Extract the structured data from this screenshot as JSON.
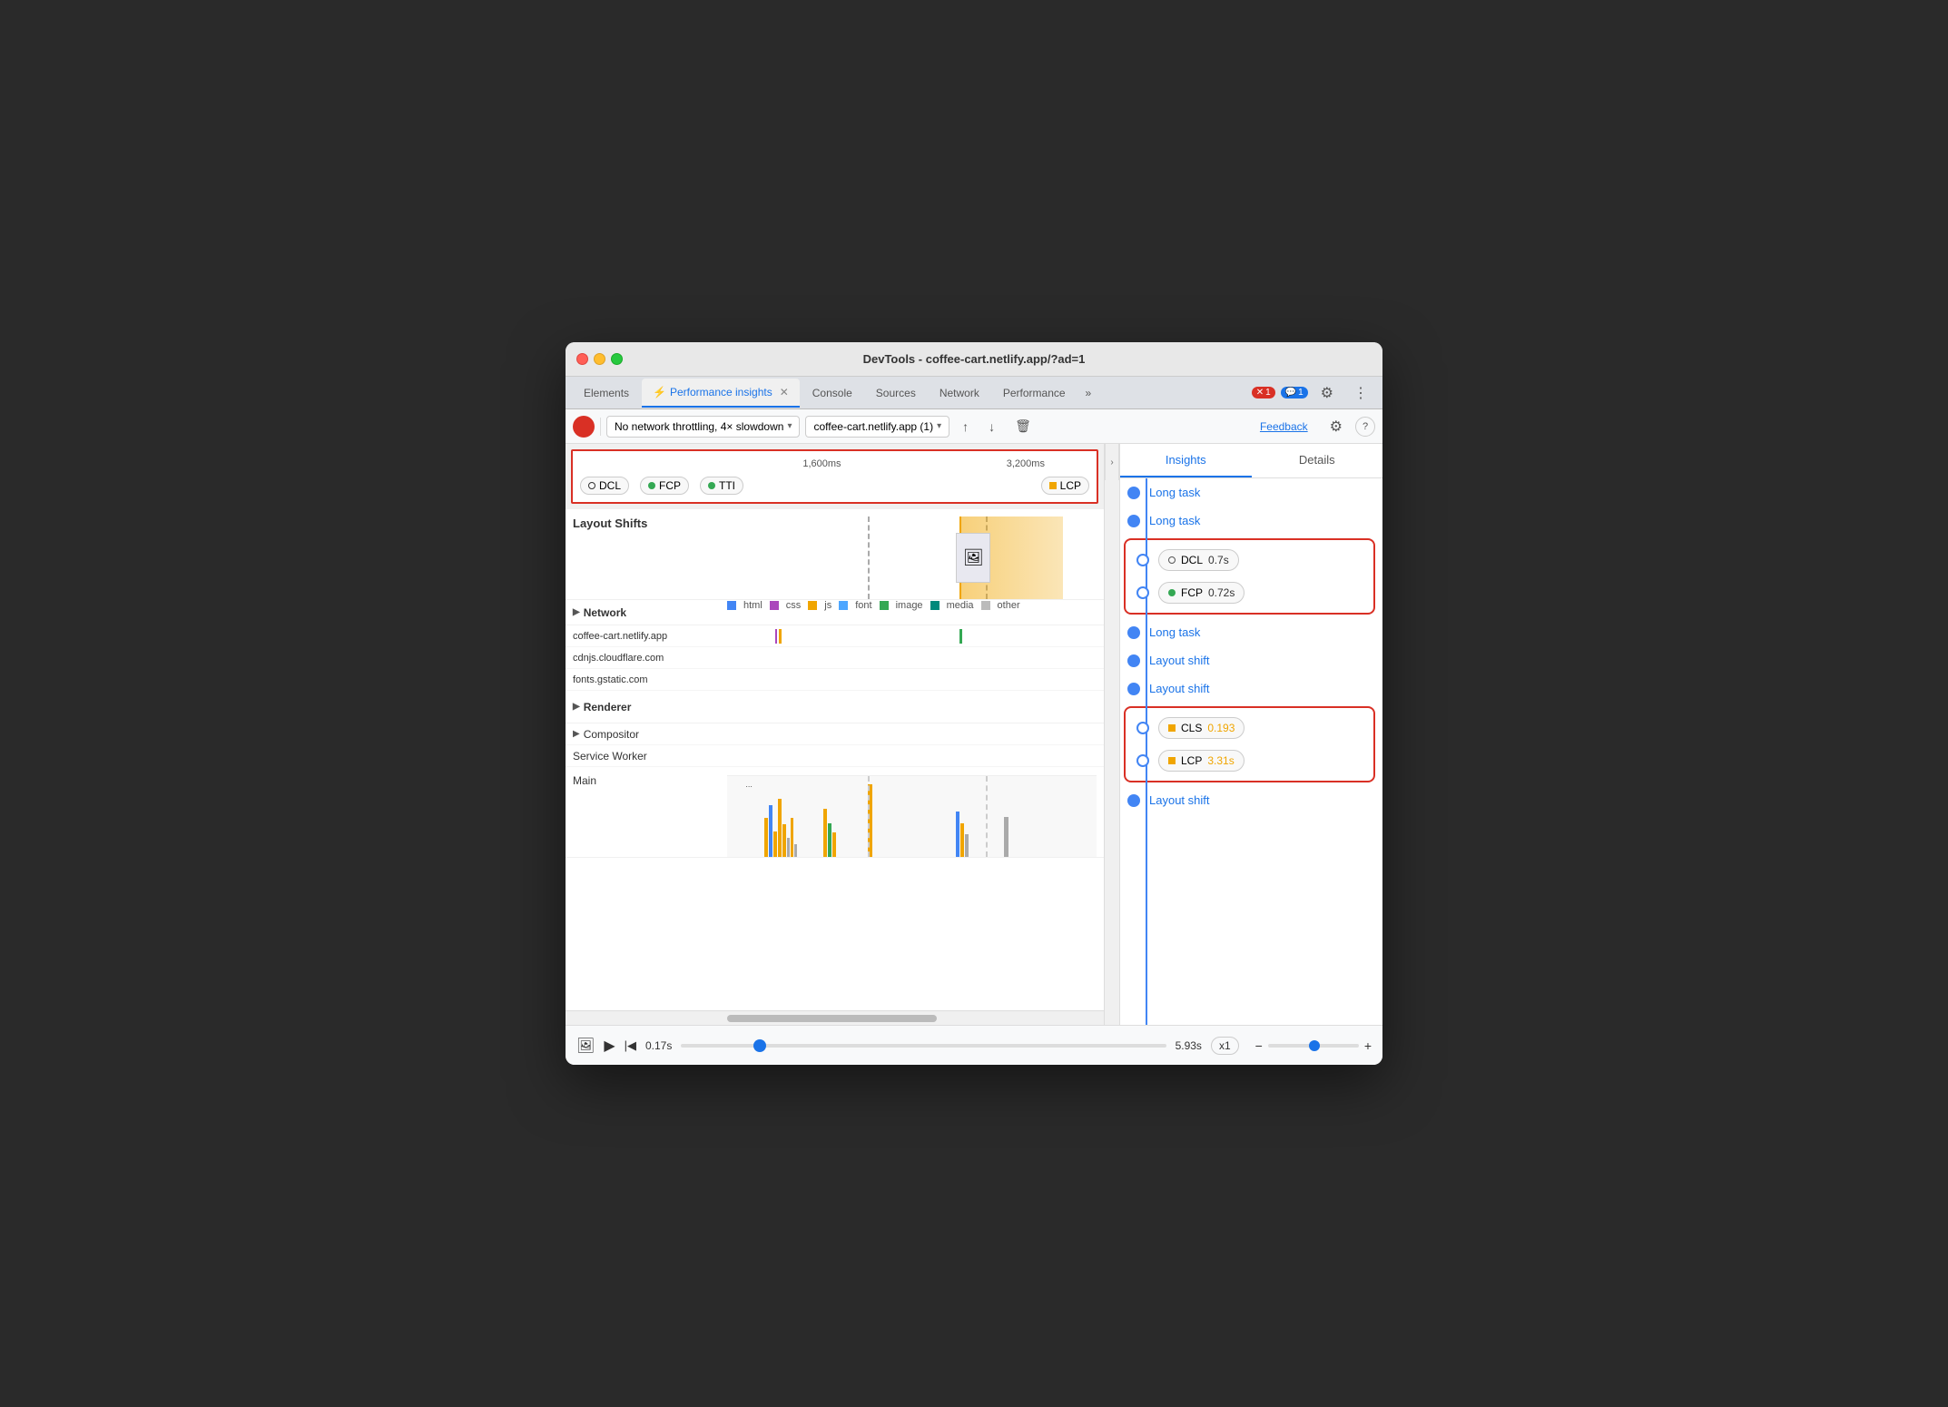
{
  "window": {
    "title": "DevTools - coffee-cart.netlify.app/?ad=1"
  },
  "tabs": [
    {
      "label": "Elements",
      "active": false
    },
    {
      "label": "Performance insights",
      "active": true,
      "icon": "⚡"
    },
    {
      "label": "Console",
      "active": false
    },
    {
      "label": "Sources",
      "active": false
    },
    {
      "label": "Network",
      "active": false
    },
    {
      "label": "Performance",
      "active": false
    }
  ],
  "tab_actions": {
    "more_label": "»",
    "errors_badge": "1",
    "messages_badge": "1",
    "settings_icon": "⚙",
    "menu_icon": "⋮"
  },
  "toolbar": {
    "record_btn_title": "Record",
    "network_throttle": "No network throttling, 4× slowdown",
    "target": "coffee-cart.netlify.app (1)",
    "upload_icon": "↑",
    "download_icon": "↓",
    "delete_icon": "🗑",
    "feedback_label": "Feedback",
    "settings_icon": "⚙",
    "help_icon": "?"
  },
  "timeline": {
    "marker_1600": "1,600ms",
    "marker_3200": "3,200ms",
    "metrics": [
      {
        "id": "DCL",
        "label": "DCL",
        "type": "ring",
        "color": "#333"
      },
      {
        "id": "FCP",
        "label": "FCP",
        "type": "dot",
        "color": "#34a853"
      },
      {
        "id": "TTI",
        "label": "TTI",
        "type": "dot",
        "color": "#34a853"
      },
      {
        "id": "LCP",
        "label": "LCP",
        "type": "square",
        "color": "#f0a500"
      }
    ],
    "rows": [
      {
        "id": "layout-shifts",
        "label": "Layout Shifts",
        "bold": true
      },
      {
        "id": "network",
        "label": "Network",
        "bold": true,
        "collapsible": true
      },
      {
        "id": "net-1",
        "label": "coffee-cart.netlify.app",
        "bold": false
      },
      {
        "id": "net-2",
        "label": "cdnjs.cloudflare.com",
        "bold": false
      },
      {
        "id": "net-3",
        "label": "fonts.gstatic.com",
        "bold": false
      },
      {
        "id": "renderer",
        "label": "Renderer",
        "bold": true,
        "collapsible": true
      },
      {
        "id": "compositor",
        "label": "Compositor",
        "bold": false,
        "collapsible": true
      },
      {
        "id": "service-worker",
        "label": "Service Worker",
        "bold": false
      },
      {
        "id": "main",
        "label": "Main",
        "bold": false
      }
    ],
    "legend": [
      {
        "label": "html",
        "color": "#4285f4"
      },
      {
        "label": "css",
        "color": "#ab47bc"
      },
      {
        "label": "js",
        "color": "#f0a500"
      },
      {
        "label": "font",
        "color": "#4da6ff"
      },
      {
        "label": "image",
        "color": "#34a853"
      },
      {
        "label": "media",
        "color": "#00897b"
      },
      {
        "label": "other",
        "color": "#bbb"
      }
    ]
  },
  "insights": {
    "tab_insights": "Insights",
    "tab_details": "Details",
    "items": [
      {
        "type": "link",
        "label": "Long task",
        "dot": "filled"
      },
      {
        "type": "link",
        "label": "Long task",
        "dot": "filled"
      },
      {
        "type": "metric-box",
        "id": "DCL",
        "label": "DCL",
        "value": "0.7s",
        "value_color": "normal",
        "dot": "outlined"
      },
      {
        "type": "metric-box",
        "id": "FCP",
        "label": "FCP",
        "value": "0.72s",
        "value_color": "normal",
        "dot": "outlined",
        "dot_color": "green"
      },
      {
        "type": "link",
        "label": "Long task",
        "dot": "filled"
      },
      {
        "type": "link",
        "label": "Layout shift",
        "dot": "filled"
      },
      {
        "type": "link",
        "label": "Layout shift",
        "dot": "filled"
      },
      {
        "type": "metric-box",
        "id": "CLS",
        "label": "CLS",
        "value": "0.193",
        "value_color": "orange",
        "dot": "outlined"
      },
      {
        "type": "metric-box",
        "id": "LCP",
        "label": "LCP",
        "value": "3.31s",
        "value_color": "orange",
        "dot": "outlined"
      },
      {
        "type": "link",
        "label": "Layout shift",
        "dot": "filled"
      }
    ]
  },
  "bottom": {
    "screenshot_icon": "🖼",
    "play_icon": "▶",
    "skip_back_icon": "|◀",
    "time_start": "0.17s",
    "time_end": "5.93s",
    "speed": "x1",
    "zoom_in": "+",
    "zoom_out": "−"
  }
}
